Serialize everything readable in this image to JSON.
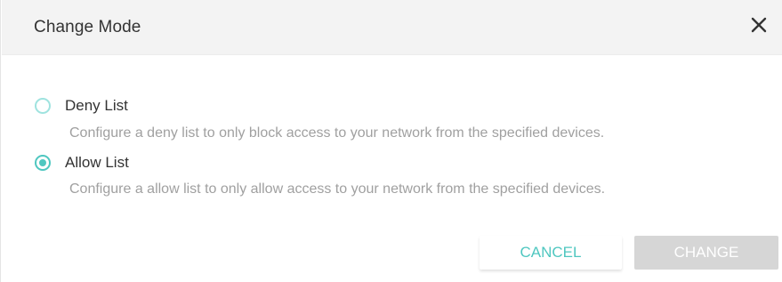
{
  "dialog": {
    "title": "Change Mode",
    "close_icon": "close-icon"
  },
  "options": [
    {
      "label": "Deny List",
      "description": "Configure a deny list to only block access to your network from the specified devices.",
      "checked": false
    },
    {
      "label": "Allow List",
      "description": "Configure a allow list to only allow access to your network from the specified devices.",
      "checked": true
    }
  ],
  "buttons": {
    "cancel": "CANCEL",
    "change": "CHANGE"
  },
  "colors": {
    "accent": "#4fc7c0",
    "accent_light": "#9fe3df",
    "disabled_button": "#d6d6d6",
    "description_text": "#a0a0a0"
  }
}
